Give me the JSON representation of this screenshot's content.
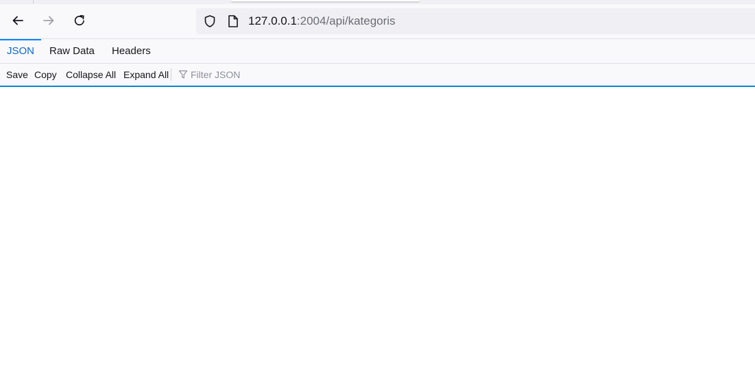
{
  "browser": {
    "url_host": "127.0.0.1",
    "url_path": ":2004/api/kategoris",
    "icons": {
      "back": "arrow-left",
      "forward": "arrow-right",
      "reload": "reload",
      "shield": "tracking-protection-shield",
      "page": "page-document"
    }
  },
  "viewer": {
    "tabs": [
      {
        "label": "JSON",
        "active": true
      },
      {
        "label": "Raw Data",
        "active": false
      },
      {
        "label": "Headers",
        "active": false
      }
    ],
    "toolbar": {
      "save_label": "Save",
      "copy_label": "Copy",
      "collapse_label": "Collapse All",
      "expand_label": "Expand All",
      "filter_placeholder": "Filter JSON"
    }
  },
  "colors": {
    "accent": "#0a84ff",
    "active_tab_text": "#0a68d6"
  }
}
